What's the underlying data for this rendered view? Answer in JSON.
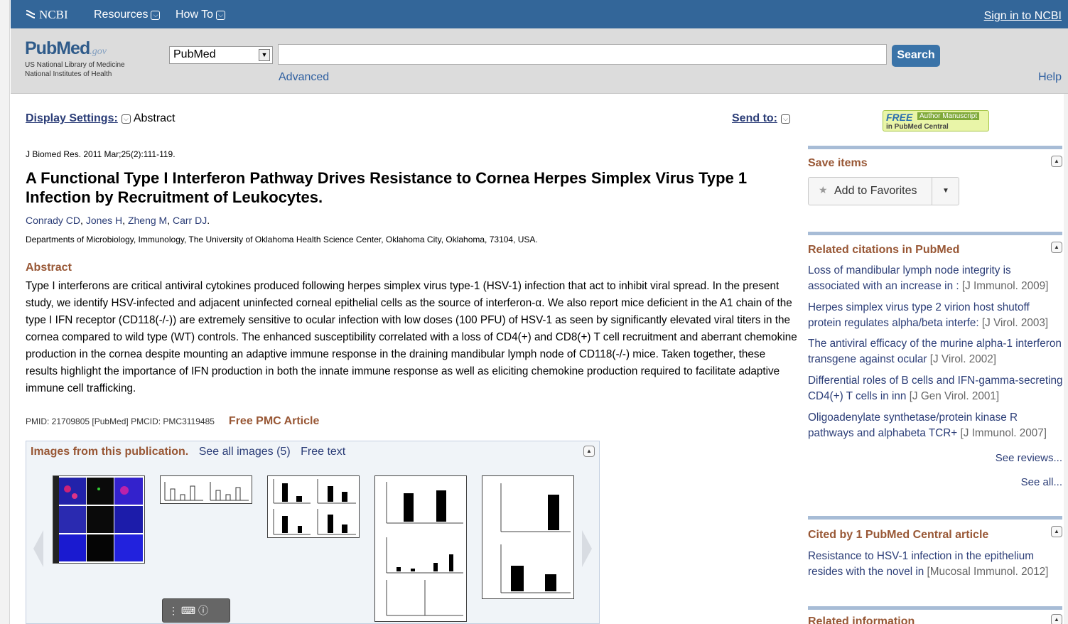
{
  "topbar": {
    "logo": "NCBI",
    "nav": [
      "Resources",
      "How To"
    ],
    "signin": "Sign in to NCBI"
  },
  "search": {
    "logo_word": "PubMed",
    "logo_gov": ".gov",
    "nlm_line1": "US National Library of Medicine",
    "nlm_line2": "National Institutes of Health",
    "database": "PubMed",
    "query": "",
    "button": "Search",
    "advanced": "Advanced",
    "help": "Help"
  },
  "display": {
    "settings_label": "Display Settings:",
    "format": "Abstract",
    "send_to": "Send to:"
  },
  "article": {
    "journal": "J Biomed Res.",
    "citation": " 2011 Mar;25(2):111-119.",
    "title": "A Functional Type I Interferon Pathway Drives Resistance to Cornea Herpes Simplex Virus Type 1 Infection by Recruitment of Leukocytes.",
    "authors": [
      "Conrady CD",
      "Jones H",
      "Zheng M",
      "Carr DJ"
    ],
    "affiliation": "Departments of Microbiology, Immunology, The University of Oklahoma Health Science Center, Oklahoma City, Oklahoma, 73104, USA.",
    "abstract_heading": "Abstract",
    "abstract": "Type I interferons are critical antiviral cytokines produced following herpes simplex virus type-1 (HSV-1) infection that act to inhibit viral spread. In the present study, we identify HSV-infected and adjacent uninfected corneal epithelial cells as the source of interferon-α. We also report mice deficient in the A1 chain of the type I IFN receptor (CD118(-/-)) are extremely sensitive to ocular infection with low doses (100 PFU) of HSV-1 as seen by significantly elevated viral titers in the cornea compared to wild type (WT) controls. The enhanced susceptibility correlated with a loss of CD4(+) and CD8(+) T cell recruitment and aberrant chemokine production in the cornea despite mounting an adaptive immune response in the draining mandibular lymph node of CD118(-/-) mice. Taken together, these results highlight the importance of IFN production in both the innate immune response as well as eliciting chemokine production required to facilitate adaptive immune cell trafficking.",
    "ids": "PMID: 21709805 [PubMed]  PMCID: PMC3119485",
    "free_pmc": "Free PMC Article"
  },
  "images": {
    "heading": "Images from this publication.",
    "see_all": "See all images (5)",
    "free_text": "Free text"
  },
  "sidebar": {
    "badge_free": "FREE",
    "badge_author": "Author Manuscript",
    "badge_pmc": "in PubMed Central",
    "save_heading": "Save items",
    "add_favorites": "Add to Favorites",
    "related_heading": "Related citations in PubMed",
    "related": [
      {
        "title": "Loss of mandibular lymph node integrity is associated with an increase in :",
        "journal": "[J Immunol. 2009]"
      },
      {
        "title": "Herpes simplex virus type 2 virion host shutoff protein regulates alpha/beta interfe:",
        "journal": "[J Virol. 2003]"
      },
      {
        "title": "The antiviral efficacy of the murine alpha-1 interferon transgene against ocular",
        "journal": "[J Virol. 2002]"
      },
      {
        "title": "Differential roles of B cells and IFN-gamma-secreting CD4(+) T cells in inn",
        "journal": "[J Gen Virol. 2001]"
      },
      {
        "title": "Oligoadenylate synthetase/protein kinase R pathways and alphabeta TCR+",
        "journal": "[J Immunol. 2007]"
      }
    ],
    "see_reviews": "See reviews...",
    "see_all": "See all...",
    "cited_heading": "Cited by 1 PubMed Central article",
    "cited": {
      "title": "Resistance to HSV-1 infection in the epithelium resides with the novel in",
      "journal": "[Mucosal Immunol. 2012]"
    },
    "related_info_heading": "Related information"
  },
  "colors": {
    "topbar": "#336699",
    "heading_brown": "#985735",
    "link_blue": "#2b3d77"
  }
}
